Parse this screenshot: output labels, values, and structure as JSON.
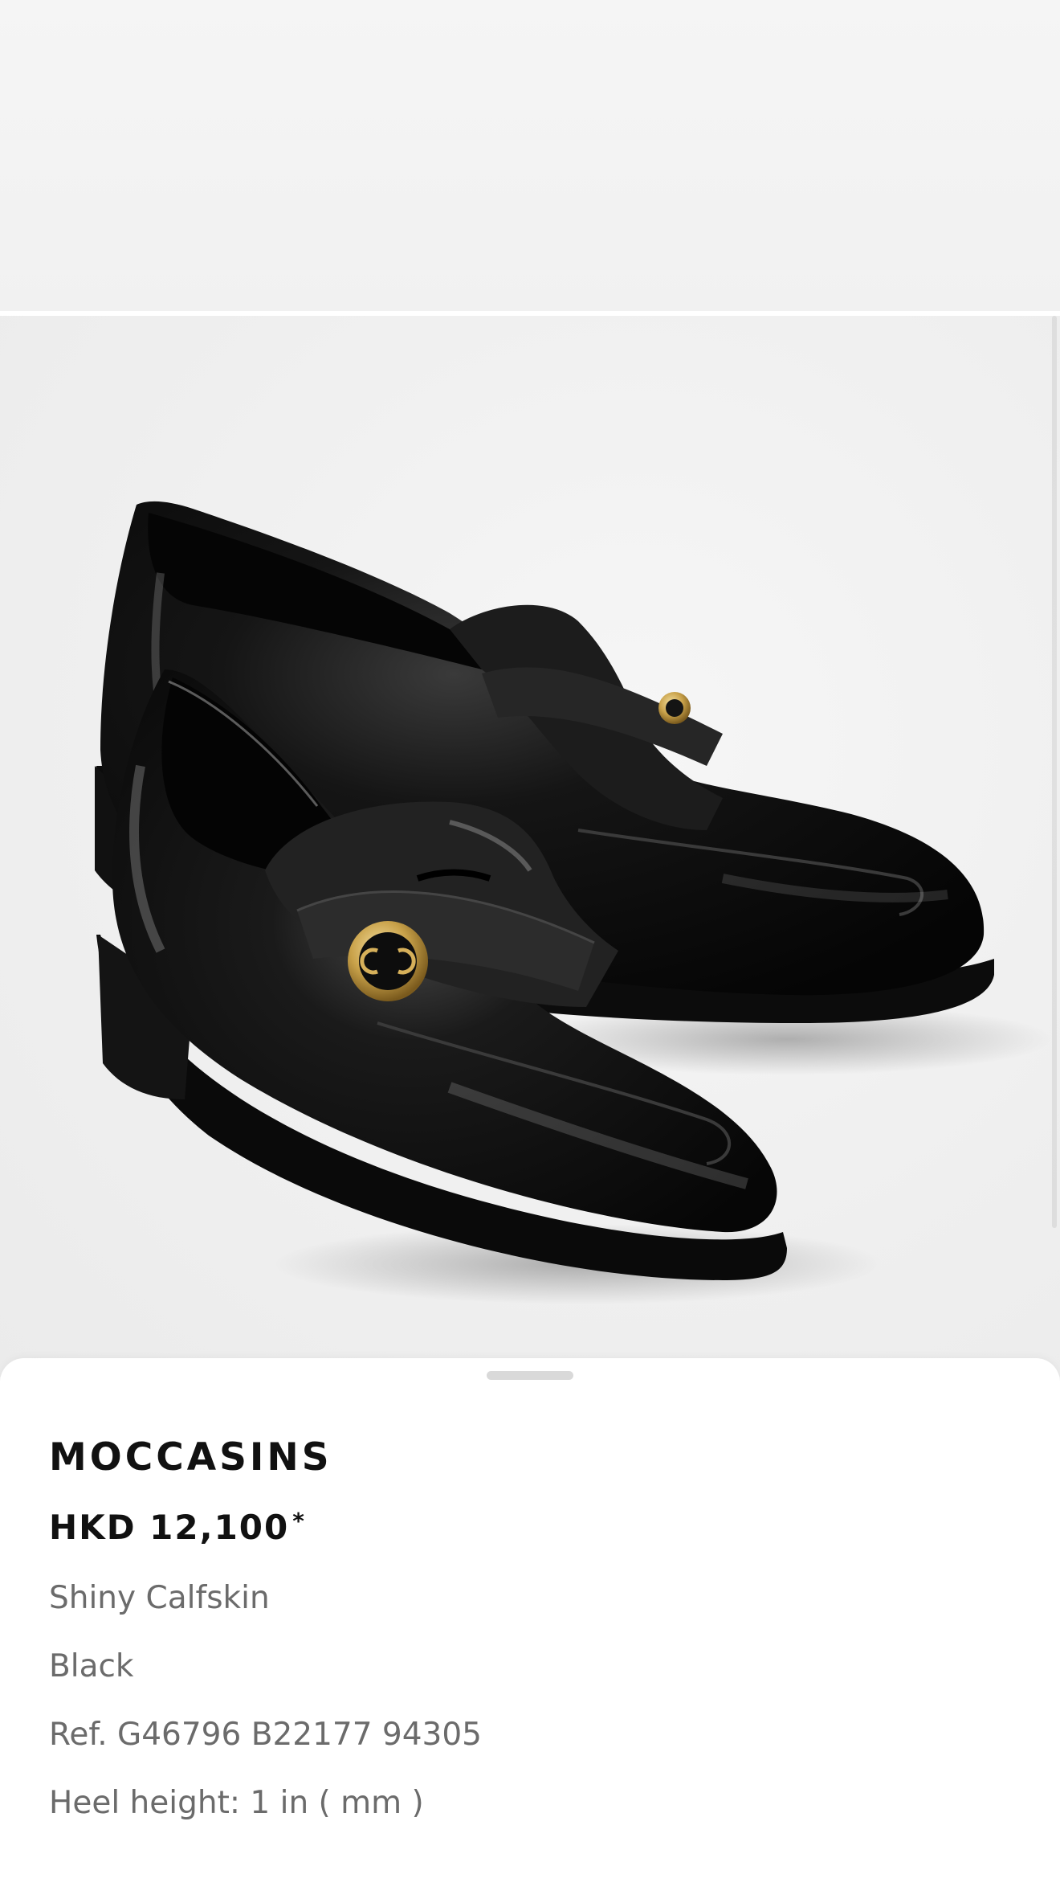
{
  "product": {
    "name": "MOCCASINS",
    "price": "HKD 12,100",
    "price_note": "*",
    "material": "Shiny Calfskin",
    "color": "Black",
    "reference": "Ref. G46796 B22177 94305",
    "heel_height": "Heel height: 1 in ( mm )"
  },
  "colors": {
    "background": "#f2f2f2",
    "sheet": "#ffffff",
    "title_text": "#111111",
    "detail_text": "#6b6b6b",
    "leather": "#111111",
    "button_gold": "#c9a24a"
  },
  "icons": {
    "product_photo": "black-loafer-photo",
    "button": "gold-cc-button-icon"
  }
}
